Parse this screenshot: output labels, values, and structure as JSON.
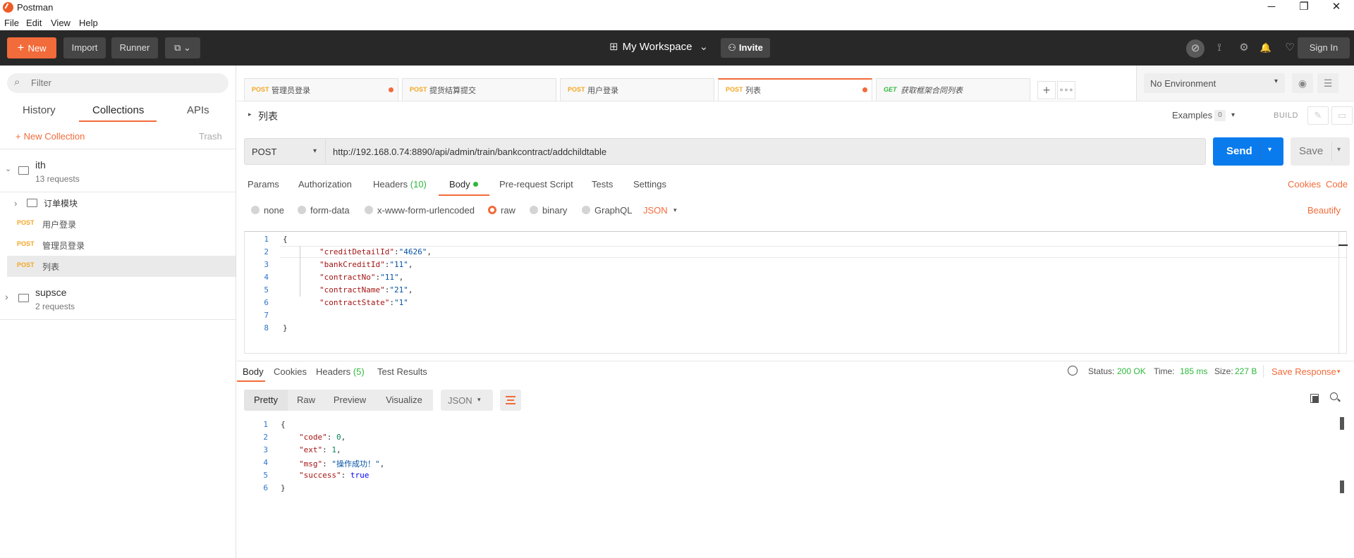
{
  "window": {
    "title": "Postman",
    "minimize": "─",
    "restore": "❐",
    "close": "✕"
  },
  "menu": [
    "File",
    "Edit",
    "View",
    "Help"
  ],
  "header": {
    "new_label": "New",
    "new_icon": "+",
    "import_label": "Import",
    "runner_label": "Runner",
    "capture_icon": "⧉ ⌄",
    "workspace_label": "My Workspace",
    "workspace_caret": "⌄",
    "workspace_icon": "⊞",
    "invite_label": "Invite",
    "invite_icon": "⚇",
    "sync_icon": "⊘",
    "satellite_icon": "⟟",
    "settings_icon": "⚙",
    "bell_icon": "🔔",
    "heart_icon": "♡",
    "signin_label": "Sign In"
  },
  "sidebar": {
    "filter_placeholder": "Filter",
    "filter_icon": "⌕",
    "tabs": [
      "History",
      "Collections",
      "APIs"
    ],
    "new_collection_label": "New Collection",
    "new_collection_icon": "+",
    "trash_label": "Trash",
    "collections": [
      {
        "name": "ith",
        "count": "13 requests",
        "arrow": "⌄"
      },
      {
        "name": "supsce",
        "count": "2 requests",
        "arrow": "›"
      }
    ],
    "folder": {
      "name": "订单模块",
      "arrow": "›"
    },
    "requests": [
      {
        "method": "POST",
        "name": "用户登录"
      },
      {
        "method": "POST",
        "name": "管理员登录"
      },
      {
        "method": "POST",
        "name": "列表"
      }
    ]
  },
  "tabs": [
    {
      "method": "POST",
      "name": "管理员登录",
      "dot": true
    },
    {
      "method": "POST",
      "name": "提货结算提交",
      "dot": false
    },
    {
      "method": "POST",
      "name": "用户登录",
      "dot": false
    },
    {
      "method": "POST",
      "name": "列表",
      "dot": true
    },
    {
      "method": "GET",
      "name": "获取框架合同列表",
      "dot": false
    }
  ],
  "tab_add": "+",
  "tab_more": "∘∘∘",
  "environment": {
    "selected": "No Environment",
    "caret": "▾",
    "eye_icon": "◉",
    "settings_icon": "☰"
  },
  "request": {
    "name": "列表",
    "name_arrow": "▸",
    "examples_label": "Examples",
    "examples_count": "0",
    "examples_caret": "▾",
    "build_label": "BUILD",
    "edit_icon": "✎",
    "comment_icon": "▭",
    "method": "POST",
    "method_caret": "▾",
    "url": "http://192.168.0.74:8890/api/admin/train/bankcontract/addchildtable",
    "send_label": "Send",
    "send_caret": "▾",
    "save_label": "Save",
    "save_caret": "▾",
    "subtabs": {
      "params": "Params",
      "authorization": "Authorization",
      "headers": "Headers",
      "headers_count": "(10)",
      "body": "Body",
      "prerequest": "Pre-request Script",
      "tests": "Tests",
      "settings": "Settings"
    },
    "cookies_link": "Cookies",
    "code_link": "Code",
    "body_types": [
      "none",
      "form-data",
      "x-www-form-urlencoded",
      "raw",
      "binary",
      "GraphQL"
    ],
    "raw_format": "JSON",
    "raw_format_caret": "▾",
    "beautify_label": "Beautify",
    "body_lines": {
      "l1": "{",
      "l2k": "\"creditDetailId\"",
      "l2v": "\"4626\"",
      "l3k": "\"bankCreditId\"",
      "l3v": "\"11\"",
      "l4k": "\"contractNo\"",
      "l4v": "\"11\"",
      "l5k": "\"contractName\"",
      "l5v": "\"21\"",
      "l6k": "\"contractState\"",
      "l6v": "\"1\"",
      "l8": "}",
      "colon": ":",
      "comma": ","
    },
    "line_numbers": [
      "1",
      "2",
      "3",
      "4",
      "5",
      "6",
      "7",
      "8"
    ]
  },
  "response": {
    "tabs": {
      "body": "Body",
      "cookies": "Cookies",
      "headers": "Headers",
      "headers_count": "(5)",
      "tests": "Test Results"
    },
    "status_label": "Status:",
    "status_value": "200 OK",
    "time_label": "Time:",
    "time_value": "185 ms",
    "size_label": "Size:",
    "size_value": "227 B",
    "save_response_label": "Save Response",
    "save_response_caret": "▾",
    "view_tabs": [
      "Pretty",
      "Raw",
      "Preview",
      "Visualize"
    ],
    "format": "JSON",
    "format_caret": "▾",
    "line_numbers": [
      "1",
      "2",
      "3",
      "4",
      "5",
      "6"
    ],
    "body_lines": {
      "l1": "{",
      "l2k": "\"code\"",
      "l2v": "0",
      "l3k": "\"ext\"",
      "l3v": "1",
      "l4k": "\"msg\"",
      "l4v": "\"操作成功！\"",
      "l5k": "\"success\"",
      "l5v": "true",
      "l6": "}",
      "colon": ": ",
      "comma": ","
    }
  },
  "colors": {
    "accent": "#f26b3a",
    "send": "#097bed",
    "post": "#f5a623",
    "get": "#2eb83e",
    "ok": "#2eb83e"
  }
}
